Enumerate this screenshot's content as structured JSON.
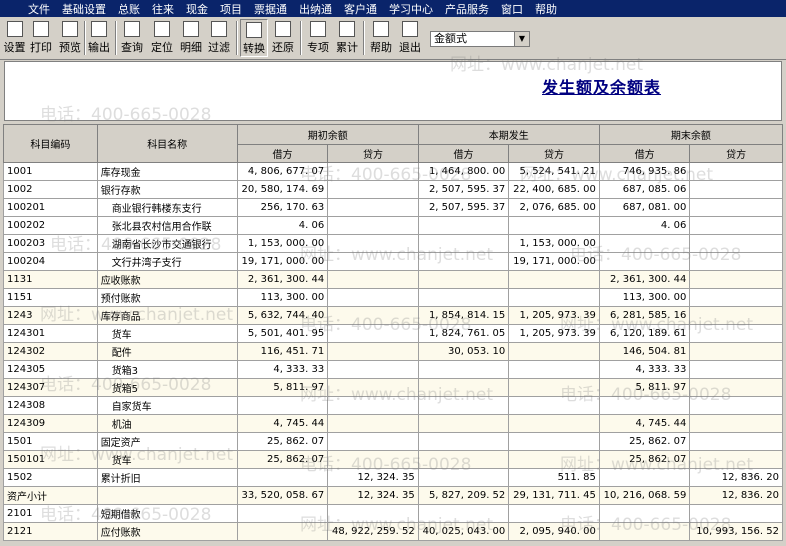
{
  "menu": [
    "文件",
    "基础设置",
    "总账",
    "往来",
    "现金",
    "项目",
    "票据通",
    "出纳通",
    "客户通",
    "学习中心",
    "产品服务",
    "窗口",
    "帮助"
  ],
  "toolbar": {
    "buttons": [
      {
        "label": "设置",
        "icon": "settings-icon"
      },
      {
        "label": "打印",
        "icon": "print-icon"
      },
      {
        "label": "预览",
        "icon": "preview-icon"
      },
      {
        "label": "输出",
        "icon": "export-icon"
      },
      {
        "label": "查询",
        "icon": "search-icon"
      },
      {
        "label": "定位",
        "icon": "locate-icon"
      },
      {
        "label": "明细",
        "icon": "detail-icon"
      },
      {
        "label": "过滤",
        "icon": "filter-icon"
      },
      {
        "label": "转换",
        "icon": "convert-icon"
      },
      {
        "label": "还原",
        "icon": "restore-icon"
      },
      {
        "label": "专项",
        "icon": "special-icon"
      },
      {
        "label": "累计",
        "icon": "sum-icon"
      },
      {
        "label": "帮助",
        "icon": "help-icon"
      },
      {
        "label": "退出",
        "icon": "exit-icon"
      }
    ],
    "format_select": "金额式"
  },
  "report_title": "发生额及余额表",
  "headers": {
    "code": "科目编码",
    "name": "科目名称",
    "opening": "期初余额",
    "current": "本期发生",
    "closing": "期末余额",
    "debit": "借方",
    "credit": "贷方"
  },
  "rows": [
    {
      "code": "1001",
      "name": "库存现金",
      "ind": 0,
      "od": "4, 806, 677. 07",
      "oc": "",
      "cd": "1, 464, 800. 00",
      "cc": "5, 524, 541. 21",
      "ed": "746, 935. 86",
      "ec": ""
    },
    {
      "code": "1002",
      "name": "银行存款",
      "ind": 0,
      "od": "20, 580, 174. 69",
      "oc": "",
      "cd": "2, 507, 595. 37",
      "cc": "22, 400, 685. 00",
      "ed": "687, 085. 06",
      "ec": ""
    },
    {
      "code": "100201",
      "name": "商业银行韩楼东支行",
      "ind": 1,
      "od": "256, 170. 63",
      "oc": "",
      "cd": "2, 507, 595. 37",
      "cc": "2, 076, 685. 00",
      "ed": "687, 081. 00",
      "ec": ""
    },
    {
      "code": "100202",
      "name": "张北县农村信用合作联",
      "ind": 1,
      "od": "4. 06",
      "oc": "",
      "cd": "",
      "cc": "",
      "ed": "4. 06",
      "ec": ""
    },
    {
      "code": "100203",
      "name": "湖南省长沙市交通银行",
      "ind": 1,
      "od": "1, 153, 000. 00",
      "oc": "",
      "cd": "",
      "cc": "1, 153, 000. 00",
      "ed": "",
      "ec": ""
    },
    {
      "code": "100204",
      "name": "文行井湾子支行",
      "ind": 1,
      "od": "19, 171, 000. 00",
      "oc": "",
      "cd": "",
      "cc": "19, 171, 000. 00",
      "ed": "",
      "ec": ""
    },
    {
      "code": "1131",
      "name": "应收账款",
      "ind": 0,
      "od": "2, 361, 300. 44",
      "oc": "",
      "cd": "",
      "cc": "",
      "ed": "2, 361, 300. 44",
      "ec": ""
    },
    {
      "code": "1151",
      "name": "预付账款",
      "ind": 0,
      "od": "113, 300. 00",
      "oc": "",
      "cd": "",
      "cc": "",
      "ed": "113, 300. 00",
      "ec": ""
    },
    {
      "code": "1243",
      "name": "库存商品",
      "ind": 0,
      "od": "5, 632, 744. 40",
      "oc": "",
      "cd": "1, 854, 814. 15",
      "cc": "1, 205, 973. 39",
      "ed": "6, 281, 585. 16",
      "ec": ""
    },
    {
      "code": "124301",
      "name": "货车",
      "ind": 1,
      "od": "5, 501, 401. 95",
      "oc": "",
      "cd": "1, 824, 761. 05",
      "cc": "1, 205, 973. 39",
      "ed": "6, 120, 189. 61",
      "ec": ""
    },
    {
      "code": "124302",
      "name": "配件",
      "ind": 1,
      "od": "116, 451. 71",
      "oc": "",
      "cd": "30, 053. 10",
      "cc": "",
      "ed": "146, 504. 81",
      "ec": ""
    },
    {
      "code": "124305",
      "name": "货箱3",
      "ind": 1,
      "od": "4, 333. 33",
      "oc": "",
      "cd": "",
      "cc": "",
      "ed": "4, 333. 33",
      "ec": ""
    },
    {
      "code": "124307",
      "name": "货箱5",
      "ind": 1,
      "od": "5, 811. 97",
      "oc": "",
      "cd": "",
      "cc": "",
      "ed": "5, 811. 97",
      "ec": ""
    },
    {
      "code": "124308",
      "name": "自家货车",
      "ind": 1,
      "od": "",
      "oc": "",
      "cd": "",
      "cc": "",
      "ed": "",
      "ec": ""
    },
    {
      "code": "124309",
      "name": "机油",
      "ind": 1,
      "od": "4, 745. 44",
      "oc": "",
      "cd": "",
      "cc": "",
      "ed": "4, 745. 44",
      "ec": ""
    },
    {
      "code": "1501",
      "name": "固定资产",
      "ind": 0,
      "od": "25, 862. 07",
      "oc": "",
      "cd": "",
      "cc": "",
      "ed": "25, 862. 07",
      "ec": ""
    },
    {
      "code": "150101",
      "name": "货车",
      "ind": 1,
      "od": "25, 862. 07",
      "oc": "",
      "cd": "",
      "cc": "",
      "ed": "25, 862. 07",
      "ec": ""
    },
    {
      "code": "1502",
      "name": "累计折旧",
      "ind": 0,
      "od": "",
      "oc": "12, 324. 35",
      "cd": "",
      "cc": "511. 85",
      "ed": "",
      "ec": "12, 836. 20"
    },
    {
      "code": "资产小计",
      "name": "",
      "ind": 0,
      "od": "33, 520, 058. 67",
      "oc": "12, 324. 35",
      "cd": "5, 827, 209. 52",
      "cc": "29, 131, 711. 45",
      "ed": "10, 216, 068. 59",
      "ec": "12, 836. 20"
    },
    {
      "code": "2101",
      "name": "短期借款",
      "ind": 0,
      "od": "",
      "oc": "",
      "cd": "",
      "cc": "",
      "ed": "",
      "ec": ""
    },
    {
      "code": "2121",
      "name": "应付账款",
      "ind": 0,
      "od": "",
      "oc": "48, 922, 259. 52",
      "cd": "40, 025, 043. 00",
      "cc": "2, 095, 940. 00",
      "ed": "",
      "ec": "10, 993, 156. 52"
    }
  ],
  "watermark": [
    "电话：400-665-0028",
    "网址：www.chanjet.net"
  ]
}
